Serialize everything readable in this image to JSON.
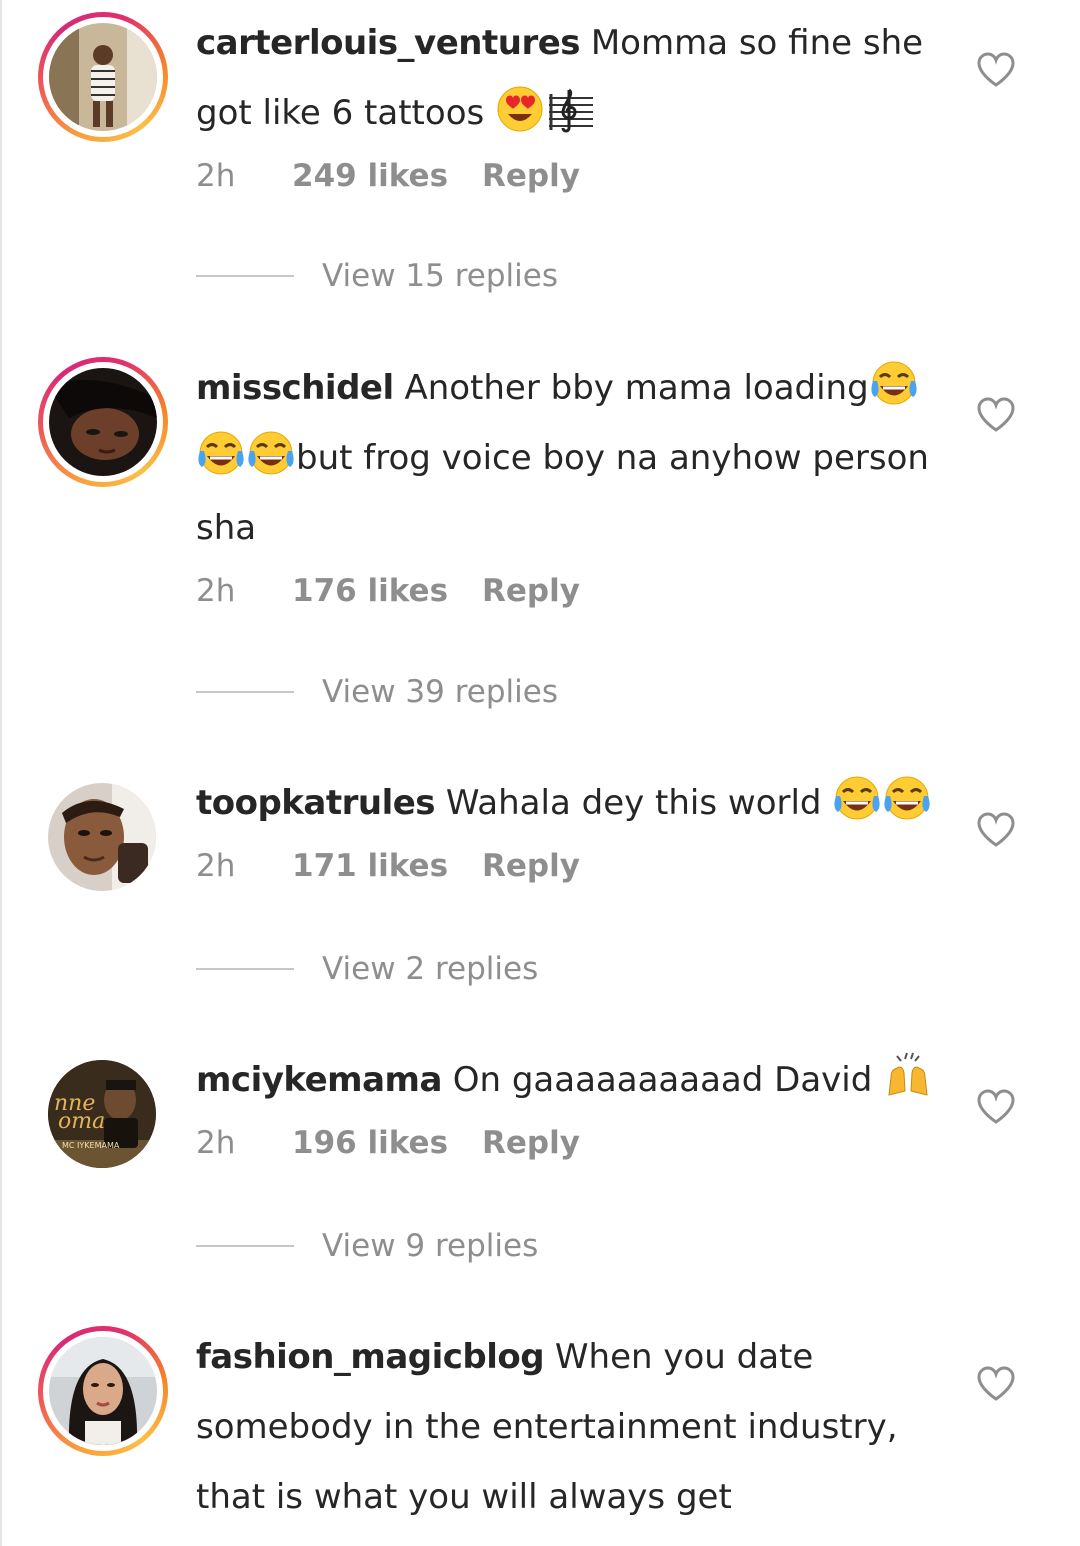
{
  "comments": [
    {
      "username": "carterlouis_ventures",
      "line1": "Momma so fine she",
      "line2": "got like 6 tattoos",
      "emoji": [
        "heart-eyes-face",
        "musical-score"
      ],
      "time": "2h",
      "likes": "249 likes",
      "reply": "Reply",
      "view_replies": "View 15 replies"
    },
    {
      "username": "misschidel",
      "line1": "Another bby mama loading",
      "line2": "but frog voice boy na anyhow person",
      "line3": "sha",
      "emoji": [
        "tears-of-joy-face",
        "tears-of-joy-face",
        "tears-of-joy-face"
      ],
      "time": "2h",
      "likes": "176 likes",
      "reply": "Reply",
      "view_replies": "View 39 replies"
    },
    {
      "username": "toopkatrules",
      "line1": "Wahala dey this world",
      "emoji": [
        "tears-of-joy-face",
        "tears-of-joy-face"
      ],
      "time": "2h",
      "likes": "171 likes",
      "reply": "Reply",
      "view_replies": "View 2 replies"
    },
    {
      "username": "mciykemama",
      "line1": "On gaaaaaaaaaad David",
      "emoji": [
        "raising-hands"
      ],
      "avatar_text": [
        "nne",
        "oma",
        "MC IYKEMAMA"
      ],
      "time": "2h",
      "likes": "196 likes",
      "reply": "Reply",
      "view_replies": "View 9 replies"
    },
    {
      "username": "fashion_magicblog",
      "line1": "When you date",
      "line2": "somebody in the entertainment industry,",
      "line3": "that is what you will always get"
    }
  ],
  "icons": {
    "like": "heart-outline-icon"
  },
  "colors": {
    "text": "#262626",
    "meta": "#8e8e8e",
    "story_ring": [
      "#f9a13b",
      "#e1306c",
      "#d62a78"
    ]
  }
}
